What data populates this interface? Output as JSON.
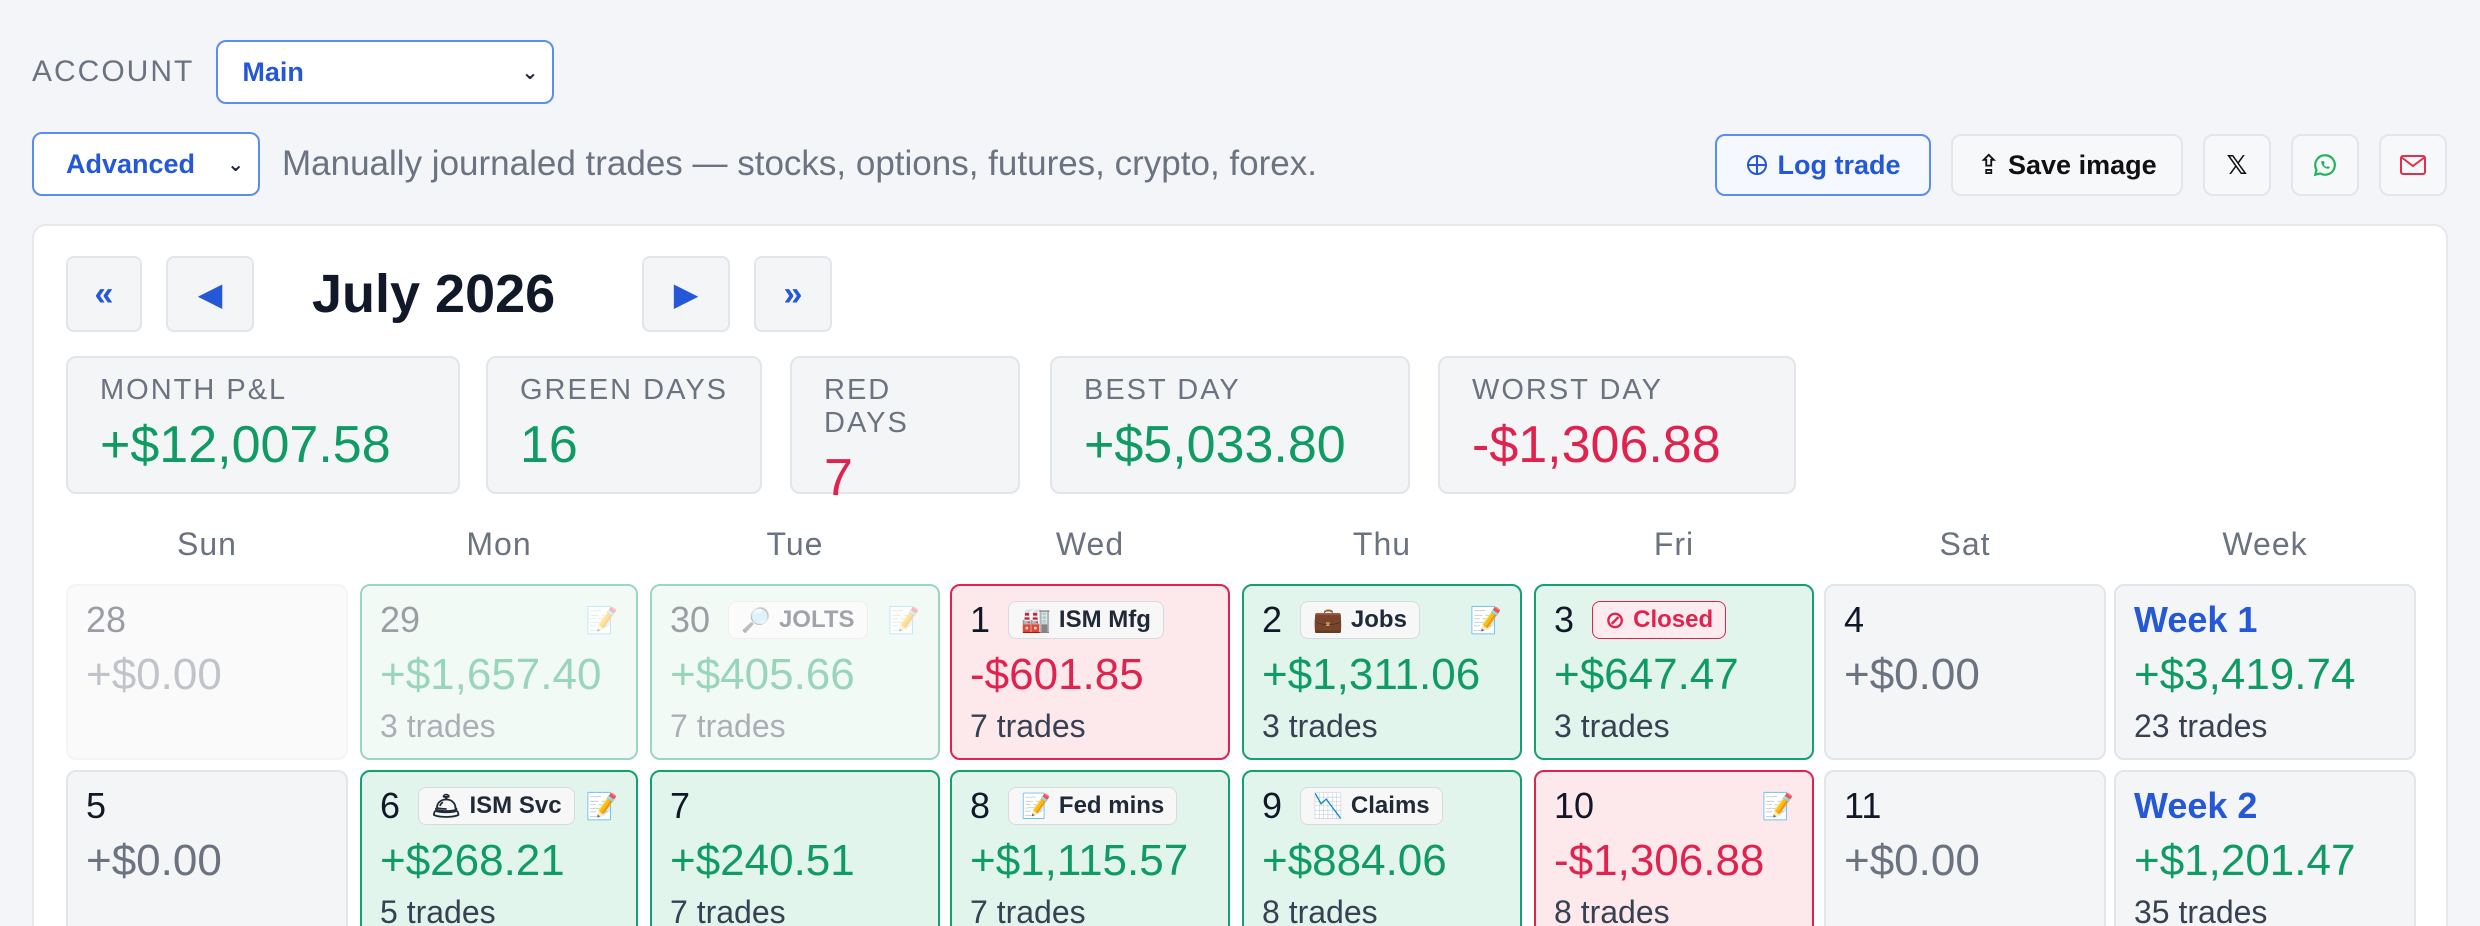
{
  "account": {
    "label": "ACCOUNT",
    "selected": "Main"
  },
  "mode": {
    "selected": "Advanced",
    "description": "Manually journaled trades — stocks, options, futures, crypto, forex."
  },
  "actions": {
    "log_trade": "Log trade",
    "save_image": "Save image",
    "x_label": "𝕏"
  },
  "nav": {
    "first": "«",
    "prev": "◀",
    "next": "▶",
    "last": "»",
    "title": "July 2026"
  },
  "stats": [
    {
      "label": "MONTH P&L",
      "value": "+$12,007.58",
      "tone": "green"
    },
    {
      "label": "GREEN DAYS",
      "value": "16",
      "tone": "green"
    },
    {
      "label": "RED DAYS",
      "value": "7",
      "tone": "red"
    },
    {
      "label": "BEST DAY",
      "value": "+$5,033.80",
      "tone": "green"
    },
    {
      "label": "WORST DAY",
      "value": "-$1,306.88",
      "tone": "red"
    }
  ],
  "weekdays": [
    "Sun",
    "Mon",
    "Tue",
    "Wed",
    "Thu",
    "Fri",
    "Sat",
    "Week"
  ],
  "weeks": [
    {
      "days": [
        {
          "day": "28",
          "pl": "+$0.00",
          "trades": "",
          "state": "empty",
          "dim": true,
          "badge": "",
          "badge_icon": "",
          "note": false
        },
        {
          "day": "29",
          "pl": "+$1,657.40",
          "trades": "3 trades",
          "state": "pos",
          "dim": true,
          "badge": "",
          "badge_icon": "",
          "note": true
        },
        {
          "day": "30",
          "pl": "+$405.66",
          "trades": "7 trades",
          "state": "pos",
          "dim": true,
          "badge": "JOLTS",
          "badge_icon": "🔎",
          "note": true
        },
        {
          "day": "1",
          "pl": "-$601.85",
          "trades": "7 trades",
          "state": "neg",
          "dim": false,
          "badge": "ISM Mfg",
          "badge_icon": "🏭",
          "note": false
        },
        {
          "day": "2",
          "pl": "+$1,311.06",
          "trades": "3 trades",
          "state": "pos",
          "dim": false,
          "badge": "Jobs",
          "badge_icon": "💼",
          "note": true
        },
        {
          "day": "3",
          "pl": "+$647.47",
          "trades": "3 trades",
          "state": "pos",
          "dim": false,
          "badge": "Closed",
          "badge_icon": "⊘",
          "note": false
        },
        {
          "day": "4",
          "pl": "+$0.00",
          "trades": "",
          "state": "empty",
          "dim": false,
          "badge": "",
          "badge_icon": "",
          "note": false
        }
      ],
      "summary": {
        "title": "Week 1",
        "pl": "+$3,419.74",
        "trades": "23 trades"
      }
    },
    {
      "days": [
        {
          "day": "5",
          "pl": "+$0.00",
          "trades": "",
          "state": "empty",
          "dim": false,
          "badge": "",
          "badge_icon": "",
          "note": false
        },
        {
          "day": "6",
          "pl": "+$268.21",
          "trades": "5 trades",
          "state": "pos",
          "dim": false,
          "badge": "ISM Svc",
          "badge_icon": "🛎",
          "note": true
        },
        {
          "day": "7",
          "pl": "+$240.51",
          "trades": "7 trades",
          "state": "pos",
          "dim": false,
          "badge": "",
          "badge_icon": "",
          "note": false
        },
        {
          "day": "8",
          "pl": "+$1,115.57",
          "trades": "7 trades",
          "state": "pos",
          "dim": false,
          "badge": "Fed mins",
          "badge_icon": "📝",
          "note": false
        },
        {
          "day": "9",
          "pl": "+$884.06",
          "trades": "8 trades",
          "state": "pos",
          "dim": false,
          "badge": "Claims",
          "badge_icon": "📉",
          "note": false
        },
        {
          "day": "10",
          "pl": "-$1,306.88",
          "trades": "8 trades",
          "state": "neg",
          "dim": false,
          "badge": "",
          "badge_icon": "",
          "note": true
        },
        {
          "day": "11",
          "pl": "+$0.00",
          "trades": "",
          "state": "empty",
          "dim": false,
          "badge": "",
          "badge_icon": "",
          "note": false
        }
      ],
      "summary": {
        "title": "Week 2",
        "pl": "+$1,201.47",
        "trades": "35 trades"
      }
    }
  ]
}
